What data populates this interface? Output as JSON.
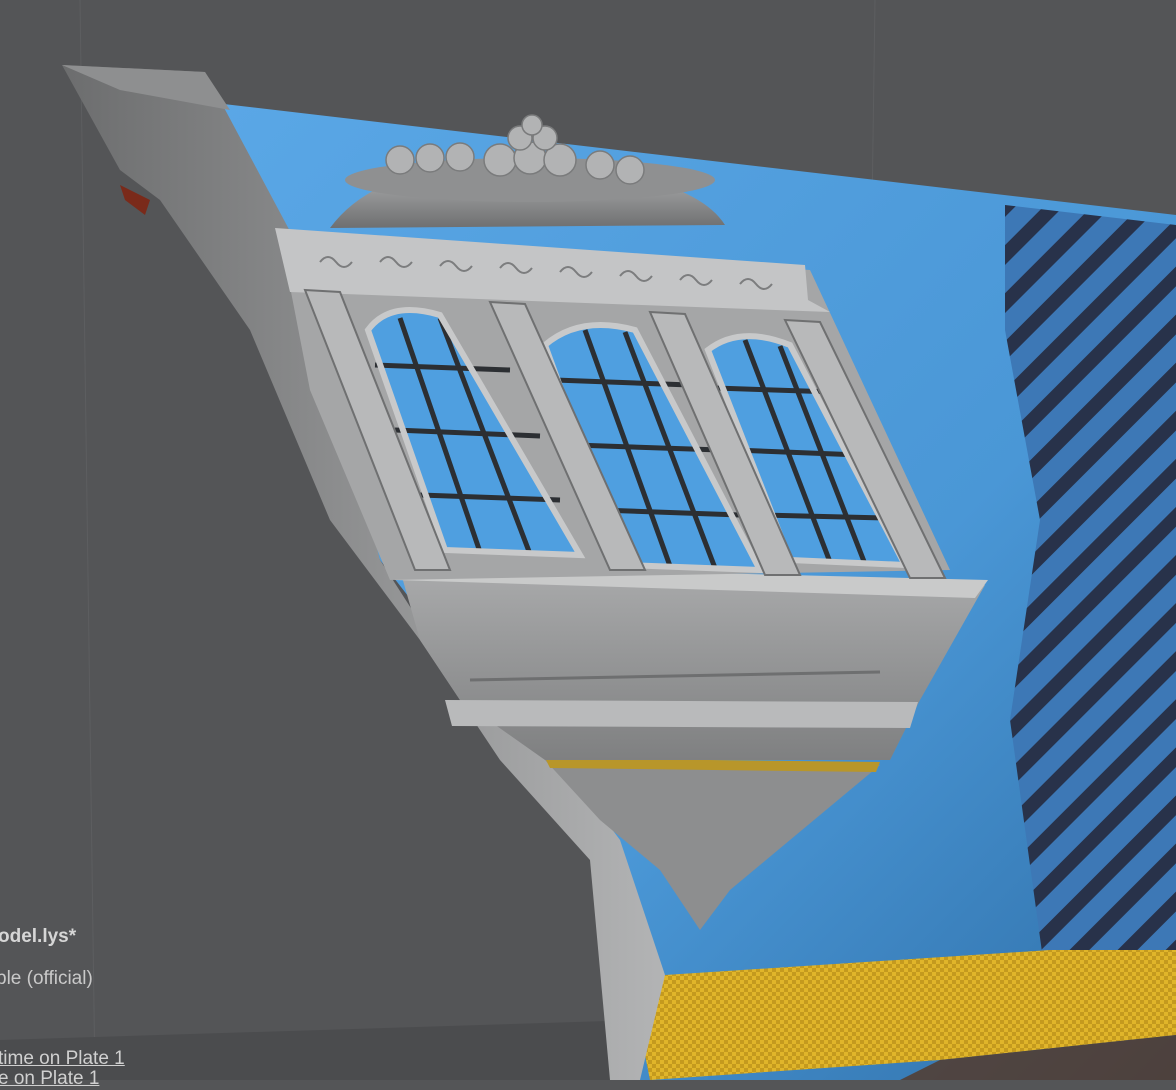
{
  "scene": {
    "filename": "odel.lys*",
    "printer": "ble (official)",
    "info_lines": [
      "time on Plate 1",
      "e on Plate 1"
    ]
  },
  "colors": {
    "background": "#545557",
    "backdrop_blue": "#4f9fe0",
    "model_gray": "#9a9b9c",
    "stripe_dark": "#2a3340"
  }
}
